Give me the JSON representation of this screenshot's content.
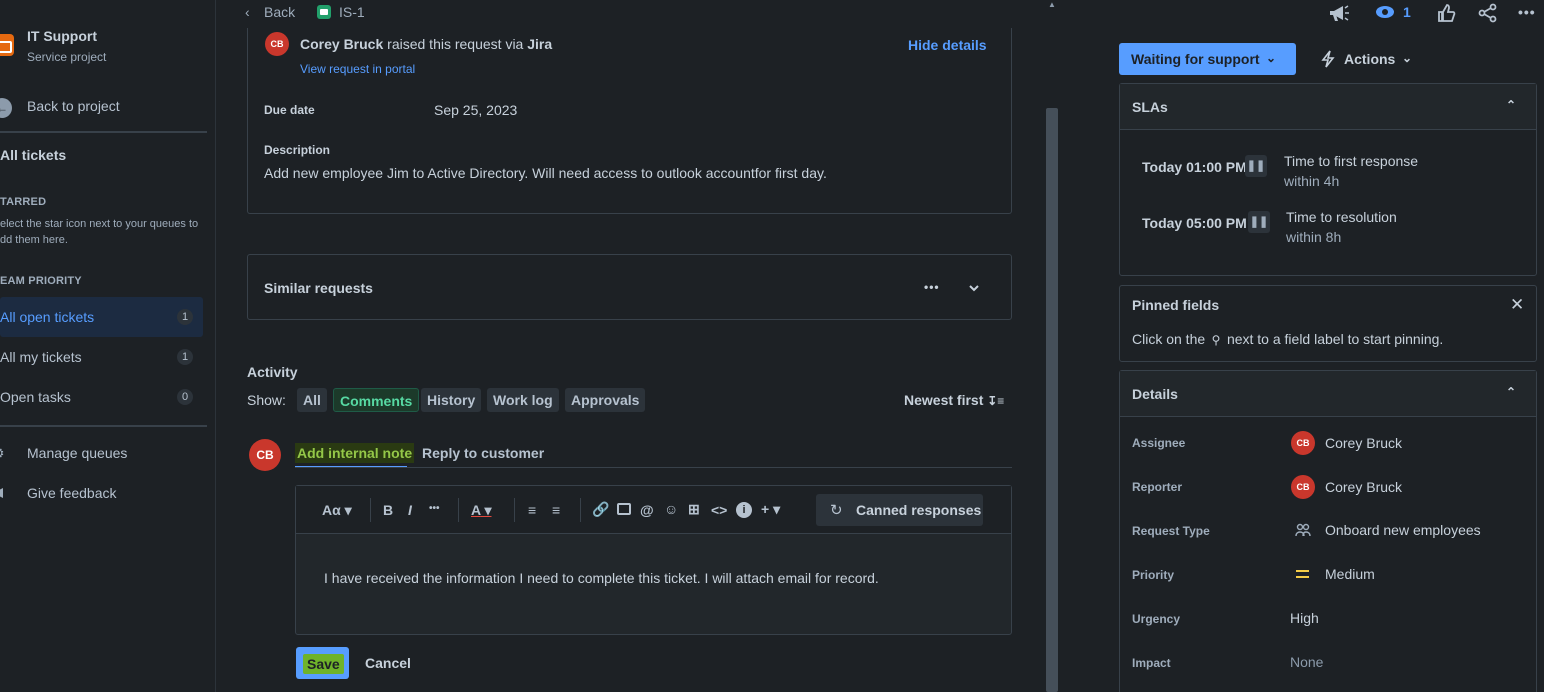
{
  "sidebar": {
    "project_name": "IT Support",
    "project_type": "Service project",
    "back_label": "Back to project",
    "all_tickets": "All tickets",
    "starred_heading": "TARRED",
    "starred_hint": "elect the star icon next to your queues to dd them here.",
    "team_priority_heading": "EAM PRIORITY",
    "queues": [
      {
        "label": "All open tickets",
        "count": "1"
      },
      {
        "label": "All my tickets",
        "count": "1"
      },
      {
        "label": "Open tasks",
        "count": "0"
      }
    ],
    "manage_queues": "Manage queues",
    "give_feedback": "Give feedback"
  },
  "topbar": {
    "back": "Back",
    "issue_key": "IS-1"
  },
  "request": {
    "avatar_initials": "CB",
    "reporter_name": "Corey Bruck",
    "raised_text": "raised this request via",
    "channel": "Jira",
    "view_portal": "View request in portal",
    "hide_details": "Hide details",
    "due_date_label": "Due date",
    "due_date_value": "Sep 25, 2023",
    "description_label": "Description",
    "description_value": "Add new employee Jim to Active Directory. Will need access to outlook accountfor first day."
  },
  "similar": {
    "title": "Similar requests",
    "more": "•••",
    "chevron": "⌄"
  },
  "activity": {
    "title": "Activity",
    "show_label": "Show:",
    "filters": [
      "All",
      "Comments",
      "History",
      "Work log",
      "Approvals"
    ],
    "selected_filter": "Comments",
    "sort": "Newest first"
  },
  "composer": {
    "avatar_initials": "CB",
    "tab_internal": "Add internal note",
    "tab_reply": "Reply to customer",
    "toolbar": {
      "text_style": "Aα",
      "bold": "B",
      "italic": "I",
      "more": "•••",
      "color": "A",
      "canned": "Canned responses"
    },
    "body_text": "I have received the information I need to complete this ticket. I will attach email for record.",
    "save": "Save",
    "cancel": "Cancel"
  },
  "header_actions": {
    "watch_count": "1"
  },
  "status": {
    "label": "Waiting for support",
    "actions": "Actions"
  },
  "slas": {
    "title": "SLAs",
    "items": [
      {
        "time": "Today 01:00 PM",
        "name": "Time to first response",
        "goal": "within 4h"
      },
      {
        "time": "Today 05:00 PM",
        "name": "Time to resolution",
        "goal": "within 8h"
      }
    ]
  },
  "pinned": {
    "title": "Pinned fields",
    "hint_before": "Click on the",
    "hint_after": "next to a field label to start pinning."
  },
  "details": {
    "title": "Details",
    "assignee_label": "Assignee",
    "assignee_initials": "CB",
    "assignee_value": "Corey Bruck",
    "reporter_label": "Reporter",
    "reporter_initials": "CB",
    "reporter_value": "Corey Bruck",
    "request_type_label": "Request Type",
    "request_type_value": "Onboard new employees",
    "priority_label": "Priority",
    "priority_value": "Medium",
    "urgency_label": "Urgency",
    "urgency_value": "High",
    "impact_label": "Impact",
    "impact_value": "None"
  },
  "colors": {
    "background": "#1d2125",
    "accent": "#579dff",
    "status_button": "#579dff",
    "highlight_green": "#4bce97",
    "avatar_red": "#c9372c",
    "priority_medium": "#f5cd47"
  }
}
